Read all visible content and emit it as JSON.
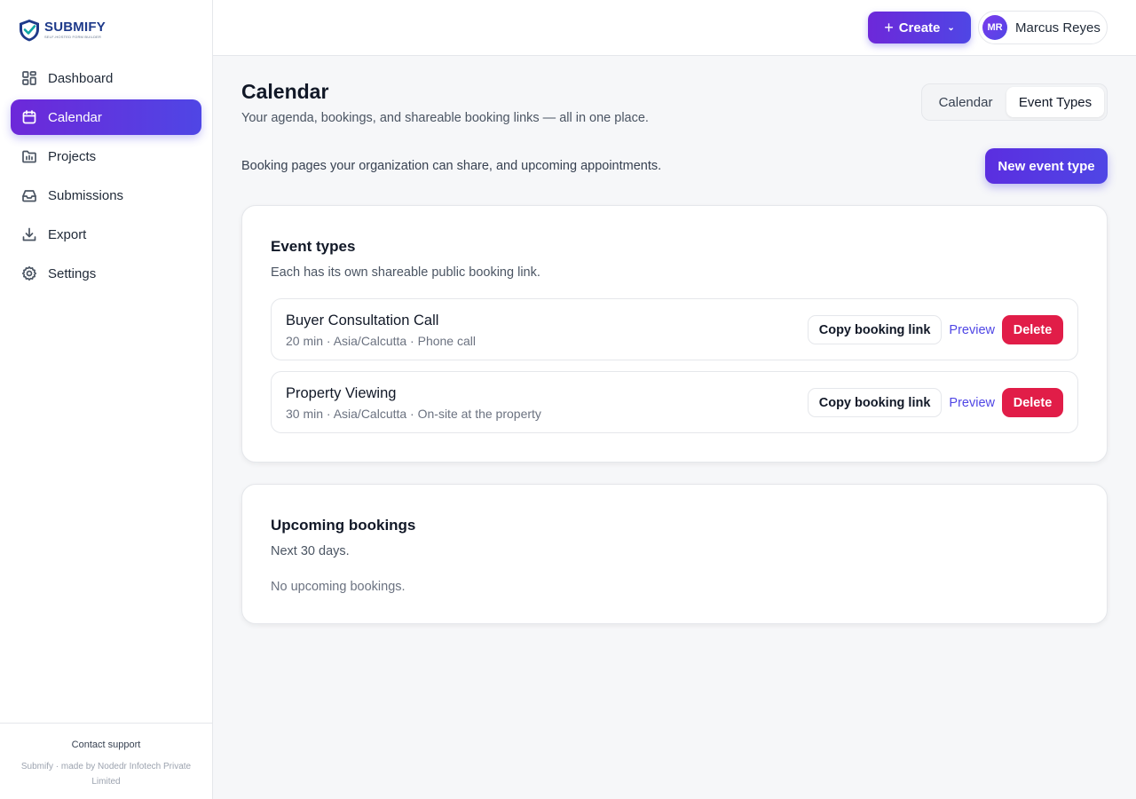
{
  "brand": {
    "name": "SUBMIFY",
    "tagline": "SELF-HOSTED FORM BUILDER",
    "logo_icon": "shield-check-icon"
  },
  "sidebar": {
    "items": [
      {
        "label": "Dashboard",
        "icon": "grid-icon",
        "active": false
      },
      {
        "label": "Calendar",
        "icon": "calendar-icon",
        "active": true
      },
      {
        "label": "Projects",
        "icon": "folder-icon",
        "active": false
      },
      {
        "label": "Submissions",
        "icon": "inbox-icon",
        "active": false
      },
      {
        "label": "Export",
        "icon": "download-icon",
        "active": false
      },
      {
        "label": "Settings",
        "icon": "gear-icon",
        "active": false
      }
    ],
    "footer": {
      "contact": "Contact support",
      "note": "Submify · made by Nodedr Infotech Private Limited"
    }
  },
  "topbar": {
    "create_label": "Create",
    "user": {
      "initials": "MR",
      "name": "Marcus Reyes"
    }
  },
  "page": {
    "title": "Calendar",
    "subtitle": "Your agenda, bookings, and shareable booking links — all in one place.",
    "tabs": {
      "calendar": "Calendar",
      "event_types": "Event Types",
      "selected": "Event Types"
    },
    "intro": "Booking pages your organization can share, and upcoming appointments.",
    "new_event_label": "New event type"
  },
  "event_types": {
    "title": "Event types",
    "subtitle": "Each has its own shareable public booking link.",
    "copy_label": "Copy booking link",
    "preview_label": "Preview",
    "delete_label": "Delete",
    "items": [
      {
        "name": "Buyer Consultation Call",
        "meta": "20 min · Asia/Calcutta · Phone call"
      },
      {
        "name": "Property Viewing",
        "meta": "30 min · Asia/Calcutta · On-site at the property"
      }
    ]
  },
  "bookings": {
    "title": "Upcoming bookings",
    "subtitle": "Next 30 days.",
    "empty": "No upcoming bookings."
  },
  "colors": {
    "accent_start": "#6d28d9",
    "accent_end": "#4f46e5",
    "danger": "#e11d48",
    "brand_text": "#1e3a8a"
  }
}
